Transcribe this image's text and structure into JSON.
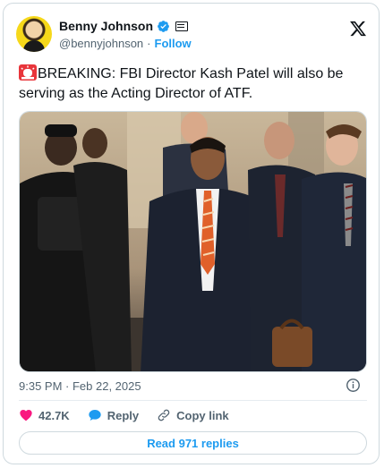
{
  "author": {
    "display_name": "Benny Johnson",
    "handle": "@bennyjohnson",
    "separator": "·",
    "follow_label": "Follow",
    "verified_color": "#1d9bf0"
  },
  "tweet": {
    "text": "BREAKING: FBI Director Kash Patel will also be serving as the Acting Director of ATF.",
    "timestamp": "9:35 PM · Feb 22, 2025"
  },
  "actions": {
    "like_count": "42.7K",
    "reply_label": "Reply",
    "copy_link_label": "Copy link"
  },
  "read_replies_label": "Read 971 replies",
  "colors": {
    "accent": "#1d9bf0",
    "like": "#f91880",
    "secondary_text": "#536471"
  },
  "icons": [
    "verified-icon",
    "affiliation-icon",
    "x-logo-icon",
    "siren-icon",
    "info-icon",
    "heart-icon",
    "reply-bubble-icon",
    "link-icon"
  ]
}
